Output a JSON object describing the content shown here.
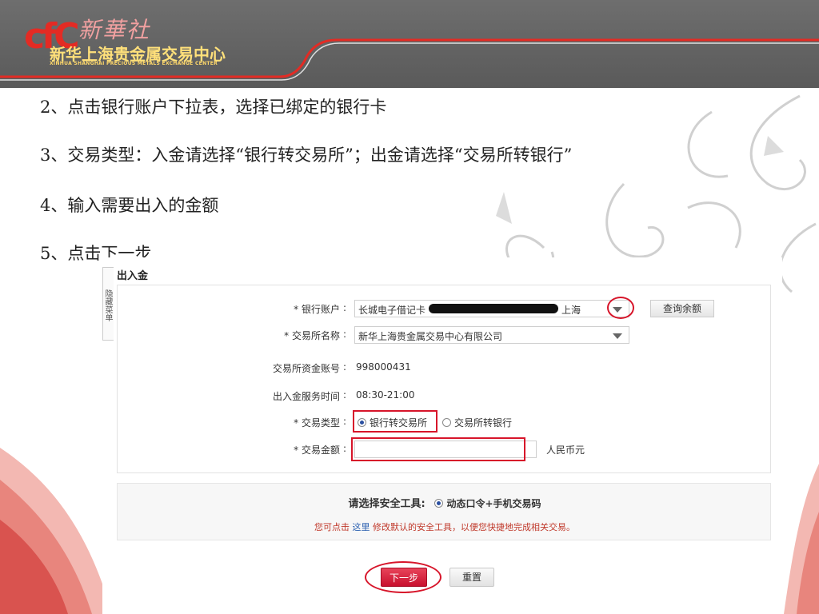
{
  "logo": {
    "mark": "cfC",
    "brand_cn": "新華社",
    "name_cn": "新华上海贵金属交易中心",
    "name_en": "XINHUA SHANGHAI PRECIOUS METALS EXCHANGE CENTER"
  },
  "steps": [
    "2、点击银行账户下拉表，选择已绑定的银行卡",
    "3、交易类型：入金请选择“银行转交易所”；出金请选择“交易所转银行”",
    "4、输入需要出入的金额",
    "5、点击下一步"
  ],
  "panel": {
    "side_tab": "隐藏菜单",
    "title": "出入金",
    "colon": ":",
    "form": {
      "bank_account": {
        "label": "* 银行账户",
        "value_prefix": "长城电子借记卡",
        "value_suffix": "上海",
        "balance_button": "查询余额"
      },
      "exchange_name": {
        "label": "* 交易所名称",
        "value": "新华上海贵金属交易中心有限公司"
      },
      "fund_account": {
        "label": "交易所资金账号",
        "value": "998000431"
      },
      "service_time": {
        "label": "出入金服务时间",
        "value": "08:30-21:00"
      },
      "trade_type": {
        "label": "* 交易类型",
        "options": [
          "银行转交易所",
          "交易所转银行"
        ],
        "selected": "银行转交易所"
      },
      "amount": {
        "label": "* 交易金额",
        "value": "",
        "unit": "人民币元"
      }
    },
    "security": {
      "label": "请选择安全工具:",
      "option": "动态口令+手机交易码",
      "hint_prefix": "您可点击",
      "hint_link": "这里",
      "hint_suffix": "修改默认的安全工具，以便您快捷地完成相关交易。"
    },
    "buttons": {
      "next": "下一步",
      "reset": "重置"
    }
  },
  "colors": {
    "highlight": "#d7152a",
    "primary_button": "#c8102e",
    "header_bg": "#5f5f5f",
    "brand_red": "#e32b24"
  }
}
